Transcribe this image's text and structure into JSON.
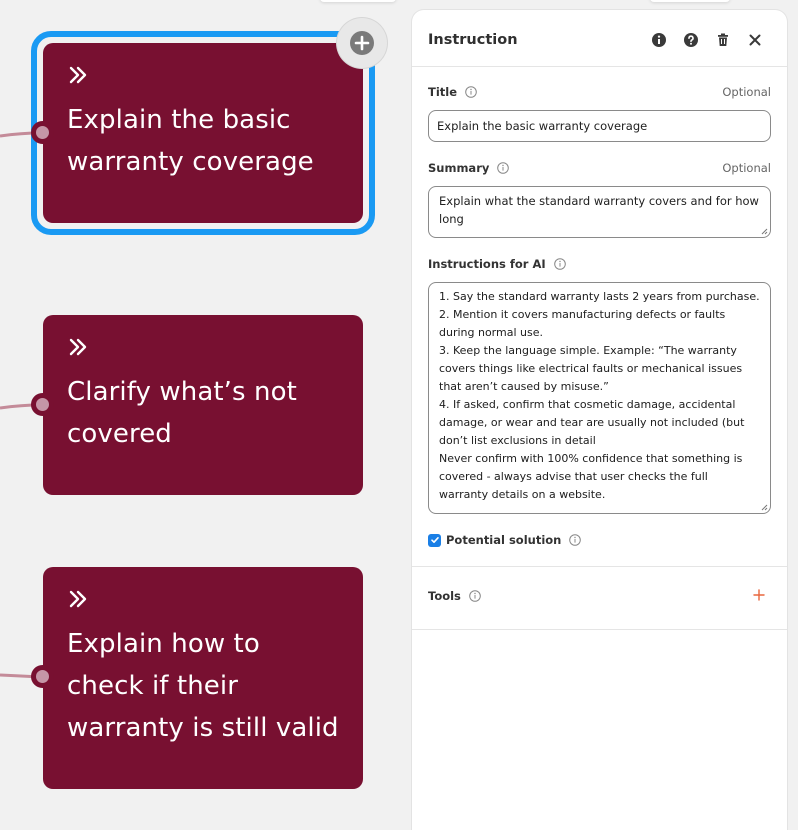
{
  "nodes": [
    {
      "label": "Explain the basic warranty coverage",
      "lines": [
        "Explain the basic",
        "warranty coverage"
      ]
    },
    {
      "label": "Clarify what’s not covered",
      "lines": [
        "Clarify what’s not",
        "covered"
      ]
    },
    {
      "label": "Explain how to check if their warranty is still valid",
      "lines": [
        "Explain how to",
        "check if their",
        "warranty is still valid"
      ]
    }
  ],
  "panel": {
    "title": "Instruction",
    "header_icons": [
      "info-icon",
      "help-icon",
      "trash-icon",
      "close-icon"
    ],
    "title_field": {
      "label": "Title",
      "optional": "Optional",
      "value": "Explain the basic warranty coverage"
    },
    "summary_field": {
      "label": "Summary",
      "optional": "Optional",
      "value": "Explain what the standard warranty covers and for how long"
    },
    "instructions_field": {
      "label": "Instructions for AI",
      "value": "1. Say the standard warranty lasts 2 years from purchase.\n2. Mention it covers manufacturing defects or faults during normal use.\n3. Keep the language simple. Example: “The warranty covers things like electrical faults or mechanical issues that aren’t caused by misuse.”\n4. If asked, confirm that cosmetic damage, accidental damage, or wear and tear are usually not included (but don’t list exclusions in detail\nNever confirm with 100% confidence that something is covered - always advise that user checks the full warranty details on a website."
    },
    "potential_solution": {
      "label": "Potential solution",
      "checked": true
    },
    "tools": {
      "label": "Tools"
    }
  },
  "colors": {
    "node_bg": "#781031",
    "selection": "#1a9af3",
    "port": "#c596a7",
    "edge": "#c48b99",
    "checkbox": "#1a7fe6",
    "tools_plus": "#e8663d"
  }
}
